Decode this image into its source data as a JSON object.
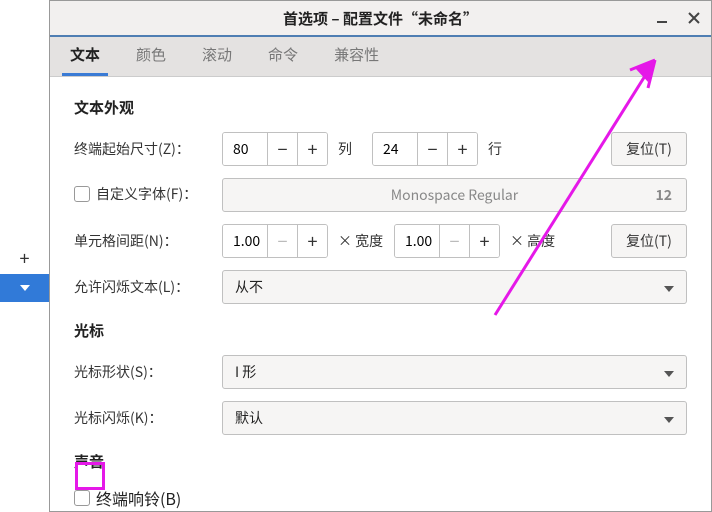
{
  "window": {
    "title": "首选项 – 配置文件“未命名”"
  },
  "tabs": {
    "text": "文本",
    "color": "颜色",
    "scroll": "滚动",
    "command": "命令",
    "compat": "兼容性"
  },
  "section": {
    "appearance": "文本外观",
    "cursor": "光标",
    "sound": "声音"
  },
  "labels": {
    "initial_size": "终端起始尺寸(Z)：",
    "custom_font": "自定义字体(F)：",
    "cell_spacing": "单元格间距(N)：",
    "allow_blinking": "允许闪烁文本(L)：",
    "cursor_shape": "光标形状(S)：",
    "cursor_blink": "光标闪烁(K)：",
    "terminal_bell": "终端响铃(B)"
  },
  "values": {
    "cols": "80",
    "rows": "24",
    "cols_suffix": "列",
    "rows_suffix": "行",
    "reset": "复位(T)",
    "font_name": "Monospace Regular",
    "font_size": "12",
    "spacing_x": "1.00",
    "spacing_y": "1.00",
    "x_width": "× 宽度",
    "x_height": "× 高度",
    "blinking_text": "从不",
    "cursor_shape": "I 形",
    "cursor_blink": "默认"
  }
}
